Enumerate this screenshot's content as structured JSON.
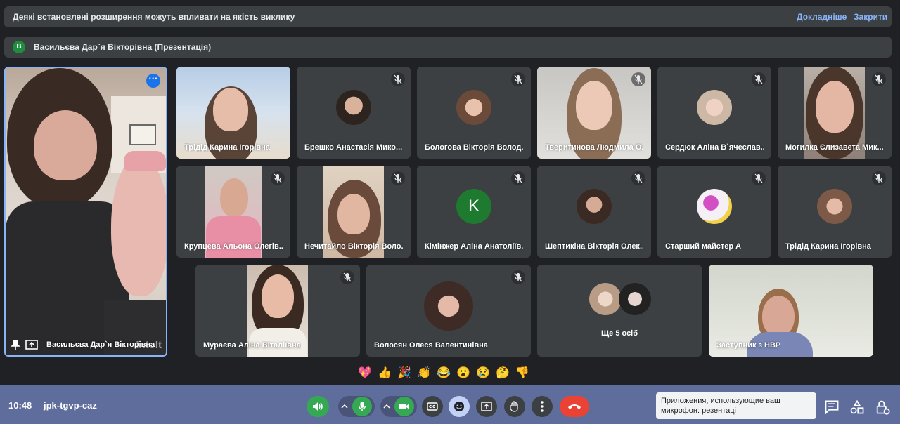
{
  "banner": {
    "message": "Деякі встановлені розширення можуть впливати на якість виклику",
    "details_link": "Докладніше",
    "close_link": "Закрити"
  },
  "presentation": {
    "avatar_letter": "В",
    "title": "Васильєва Дар`я Вікторівна (Презентація)"
  },
  "featured": {
    "name": "Васильєва Дар`я Вікторівна",
    "watermark": "IntoIt"
  },
  "participants": [
    {
      "name": "Трідід Карина Ігорівна"
    },
    {
      "name": "Брешко Анастасія Мико..."
    },
    {
      "name": "Бологова Вікторія Волод..."
    },
    {
      "name": "Тверитинова Людмила О..."
    },
    {
      "name": "Сердюк Аліна В`ячеслав..."
    },
    {
      "name": "Могилка Єлизавета Мик..."
    },
    {
      "name": "Крупцева Альона Олегів..."
    },
    {
      "name": "Нечитайло Вікторія Воло..."
    },
    {
      "name": "Кімінжер Аліна Анатоліїв...",
      "avatar_letter": "K"
    },
    {
      "name": "Шептикіна Вікторія Олек..."
    },
    {
      "name": "Старший майстер А"
    },
    {
      "name": "Трідід Карина Ігорівна"
    },
    {
      "name": "Мураєва Аліна Віталіївна"
    },
    {
      "name": "Волосян Олеся Валентинівна"
    },
    {
      "name": "Ще 5 осіб"
    },
    {
      "name": "Заступник з НВР"
    }
  ],
  "reactions": [
    "💖",
    "👍",
    "🎉",
    "👏",
    "😂",
    "😮",
    "😢",
    "🤔",
    "👎"
  ],
  "bottombar": {
    "time": "10:48",
    "meeting_code": "jpk-tgvp-caz"
  },
  "toast": {
    "text": "Приложения, использующие ваш микрофон: резентаці"
  },
  "colors": {
    "accent": "#8ab4f8",
    "bar": "#5e6d9c",
    "end_call": "#ea4335",
    "mic_on": "#34a853"
  }
}
